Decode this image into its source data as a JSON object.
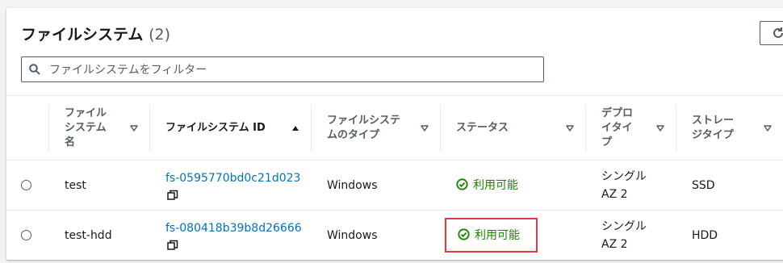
{
  "header": {
    "title": "ファイルシステム",
    "count": "(2)"
  },
  "search": {
    "placeholder": "ファイルシステムをフィルター"
  },
  "columns": {
    "name": [
      "ファイル",
      "システム",
      "名"
    ],
    "id": "ファイルシステム ID",
    "type": [
      "ファイルシステ",
      "ムのタイプ"
    ],
    "status": "ステータス",
    "deployment": [
      "デプロ",
      "イタイ",
      "プ"
    ],
    "storage": [
      "ストレー",
      "ジタイプ"
    ]
  },
  "rows": [
    {
      "name": "test",
      "id": "fs-0595770bd0c21d023",
      "type": "Windows",
      "status": "利用可能",
      "deployment": [
        "シングル",
        "AZ 2"
      ],
      "storage": "SSD"
    },
    {
      "name": "test-hdd",
      "id": "fs-080418b39b8d26666",
      "type": "Windows",
      "status": "利用可能",
      "deployment": [
        "シングル",
        "AZ 2"
      ],
      "storage": "HDD"
    }
  ],
  "colors": {
    "link": "#0073bb",
    "success": "#1d8102",
    "highlight_box": "#e0393e"
  }
}
